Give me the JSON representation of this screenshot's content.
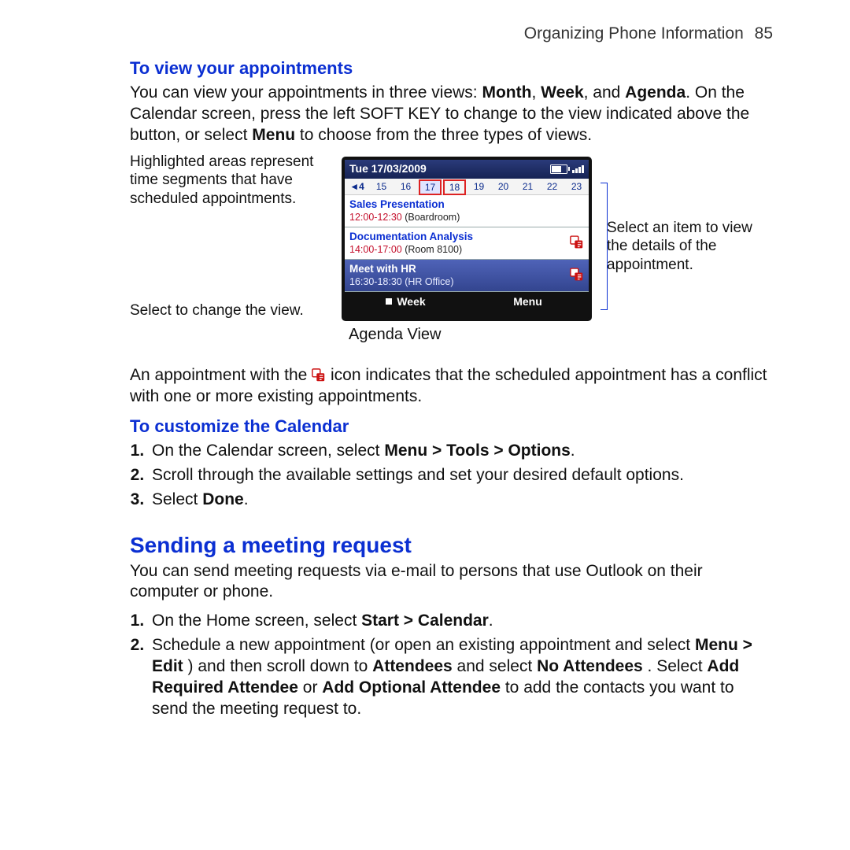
{
  "runhead": {
    "title": "Organizing Phone Information",
    "page": "85"
  },
  "sec1": {
    "heading": "To view your appointments",
    "p_parts": [
      "You can view your appointments in three views: ",
      "Month",
      ", ",
      "Week",
      ", and ",
      "Agenda",
      ". On the Calendar screen, press the left SOFT KEY to change to the view indicated above the button, or select ",
      "Menu",
      " to choose from the three types of views."
    ]
  },
  "callouts": {
    "left1": "Highlighted areas represent time segments that have scheduled appointments.",
    "left2": "Select to change the view.",
    "right": "Select an item to view the details of the appointment."
  },
  "phone": {
    "date": "Tue 17/03/2009",
    "dates": [
      "◄4",
      "15",
      "16",
      "17",
      "18",
      "19",
      "20",
      "21",
      "22",
      "23"
    ],
    "appts": [
      {
        "title": "Sales Presentation",
        "time": "12:00-12:30",
        "loc": "(Boardroom)",
        "conflict": false,
        "selected": false
      },
      {
        "title": "Documentation Analysis",
        "time": "14:00-17:00",
        "loc": "(Room 8100)",
        "conflict": true,
        "selected": false
      },
      {
        "title": "Meet with HR",
        "time": "16:30-18:30",
        "loc": "(HR Office)",
        "conflict": true,
        "selected": true
      }
    ],
    "soft_left": "Week",
    "soft_right": "Menu",
    "caption": "Agenda View"
  },
  "icon_para": {
    "before": "An appointment with the ",
    "after": " icon indicates that the scheduled appointment has a conflict with one or more existing appointments."
  },
  "sec2": {
    "heading": "To customize the Calendar",
    "steps": [
      {
        "pre": "On the Calendar screen, select ",
        "bold": "Menu > Tools > Options",
        "post": "."
      },
      {
        "text": "Scroll through the available settings and set your desired default options."
      },
      {
        "pre": "Select ",
        "bold": "Done",
        "post": "."
      }
    ]
  },
  "sec3": {
    "heading": "Sending a meeting request",
    "intro": "You can send meeting requests via e-mail to persons that use Outlook on their computer or phone.",
    "steps": [
      {
        "pre": "On the Home screen, select ",
        "bold": "Start > Calendar",
        "post": "."
      },
      {
        "parts": [
          "Schedule a new appointment (or open an existing appointment and select ",
          "Menu > Edit",
          ") and then scroll down to ",
          "Attendees",
          " and select ",
          "No Attendees",
          ". Select ",
          "Add Required Attendee",
          " or ",
          "Add Optional Attendee",
          " to add the contacts you want to send the meeting request to."
        ]
      }
    ]
  }
}
